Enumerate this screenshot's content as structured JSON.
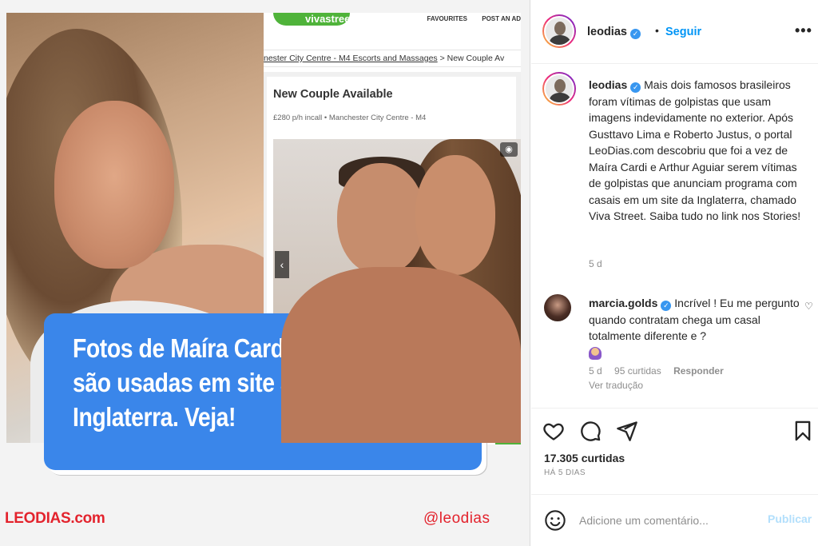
{
  "post_media": {
    "site": {
      "logo_text": "vivastreet",
      "nav": [
        "FAVOURITES",
        "POST AN AD"
      ],
      "breadcrumb_link": "nester City Centre - M4 Escorts and Massages",
      "breadcrumb_rest": " > New Couple Av",
      "ad_title": "New Couple Available",
      "ad_subtitle": "£280 p/h incall • Manchester City Centre - M4"
    },
    "headline_lines": [
      "Fotos de Maíra Cardi e Arthur",
      "são usadas em site adulto na",
      "Inglaterra. Veja!"
    ],
    "brand_left": "LEODIAS.com",
    "brand_right": "@leodias"
  },
  "header": {
    "username": "leodias",
    "separator": "•",
    "follow_label": "Seguir",
    "more_label": "•••"
  },
  "caption": {
    "username": "leodias",
    "text": "Mais dois famosos brasileiros foram vítimas de golpistas que usam imagens indevidamente no exterior. Após Gusttavo Lima e Roberto Justus, o portal LeoDias.com descobriu que foi a vez de Maíra Cardi e Arthur Aguiar serem vítimas de golpistas que anunciam programa com casais em um site da Inglaterra, chamado Viva Street. Saiba tudo no link nos Stories!",
    "time": "5 d"
  },
  "comment": {
    "username": "marcia.golds",
    "text": "Incrível ! Eu me pergunto quando contratam chega um casal totalmente diferente e ?",
    "time": "5 d",
    "likes": "95 curtidas",
    "reply_label": "Responder",
    "translate_label": "Ver tradução"
  },
  "actions": {
    "likes": "17.305 curtidas",
    "date": "HÁ 5 DIAS"
  },
  "comment_bar": {
    "placeholder": "Adicione um comentário...",
    "publish_label": "Publicar"
  },
  "colors": {
    "link_blue": "#0095f6",
    "brand_red": "#e3232d",
    "headline_blue": "#3a86ea",
    "site_green": "#4fb33a"
  },
  "icons": [
    "verified-icon",
    "more-icon",
    "heart-icon",
    "comment-icon",
    "share-icon",
    "bookmark-icon",
    "emoji-icon",
    "camera-icon",
    "chevron-left-icon"
  ]
}
